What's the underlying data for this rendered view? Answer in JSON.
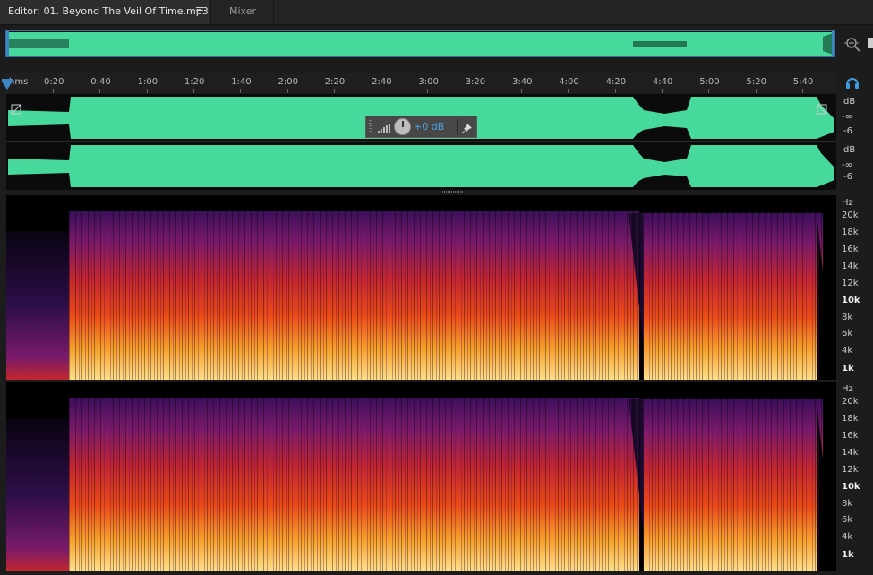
{
  "tabs": {
    "editor_label": "Editor: 01. Beyond The Veil Of Time.mp3",
    "mixer_label": "Mixer"
  },
  "ruler": {
    "unit": "hms",
    "ticks": [
      "0:20",
      "0:40",
      "1:00",
      "1:20",
      "1:40",
      "2:00",
      "2:20",
      "2:40",
      "3:00",
      "3:20",
      "3:40",
      "4:00",
      "4:20",
      "4:40",
      "5:00",
      "5:20",
      "5:40"
    ]
  },
  "hud": {
    "gain_value": "+0 dB"
  },
  "amplitude_scale": {
    "channel_1": {
      "unit": "dB",
      "inf": "-∞",
      "mid": "-6"
    },
    "channel_2": {
      "unit": "dB",
      "inf": "-∞",
      "mid": "-6"
    }
  },
  "frequency_scale": {
    "unit": "Hz",
    "labels": [
      "20k",
      "18k",
      "16k",
      "14k",
      "12k",
      "10k",
      "8k",
      "6k",
      "4k",
      "1k"
    ]
  },
  "colors": {
    "waveform": "#47d89c",
    "selection_border": "#3a6e9e",
    "accent": "#4aa3df"
  }
}
